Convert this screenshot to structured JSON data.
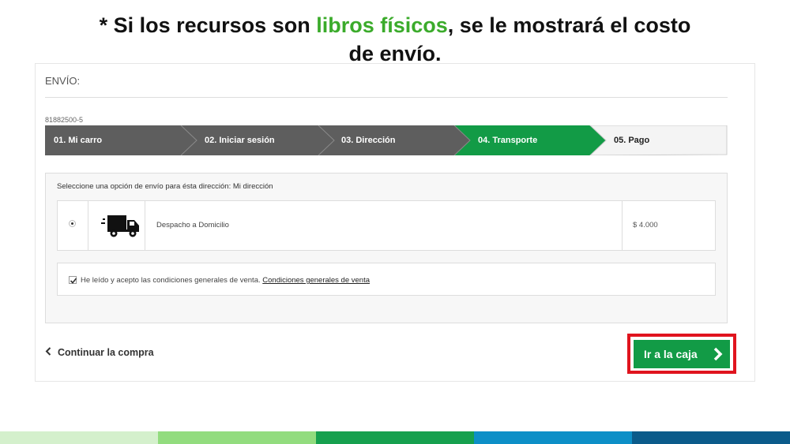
{
  "headline": {
    "part1": "* Si los recursos son ",
    "highlight": "libros físicos",
    "part2": ", se le mostrará el costo",
    "line2": "de envío."
  },
  "panel": {
    "title": "ENVÍO:",
    "order_id": "81882500-5"
  },
  "steps": [
    {
      "label": "01. Mi carro",
      "state": "done"
    },
    {
      "label": "02. Iniciar sesión",
      "state": "done"
    },
    {
      "label": "03. Dirección",
      "state": "done"
    },
    {
      "label": "04. Transporte",
      "state": "active"
    },
    {
      "label": "05. Pago",
      "state": "pending"
    }
  ],
  "shipping": {
    "prompt": "Seleccione una opción de envío para ésta dirección: Mi dirección",
    "option": {
      "icon": "truck-icon",
      "name": "Despacho a Domicilio",
      "price": "$ 4.000",
      "selected": true
    },
    "terms": {
      "checked": true,
      "text": "He leído y acepto las condiciones generales de venta.",
      "link": "Condiciones generales de venta"
    }
  },
  "actions": {
    "continue_label": "Continuar la compra",
    "checkout_label": "Ir a la caja"
  },
  "colors": {
    "accent_green": "#129b46",
    "headline_green": "#3bab2b",
    "highlight_red": "#e0141e",
    "step_done": "#5e5e5e",
    "footer": [
      "#d4f0cc",
      "#92dc7e",
      "#16a04e",
      "#0d8fc7",
      "#0b5b8a"
    ]
  }
}
